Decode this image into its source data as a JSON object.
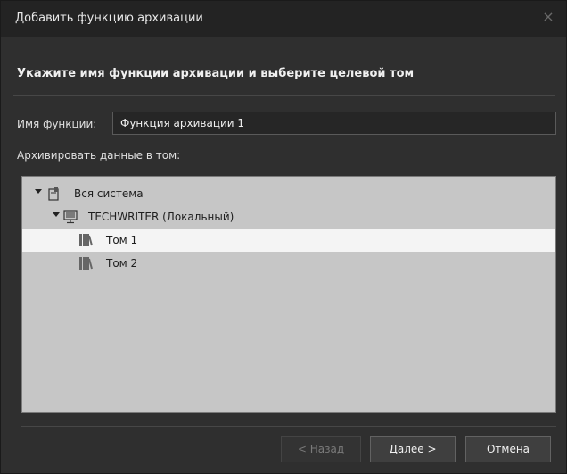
{
  "dialog": {
    "title": "Добавить функцию архивации",
    "close_glyph": "×",
    "heading": "Укажите имя функции архивации и выберите целевой том"
  },
  "form": {
    "name_label": "Имя функции:",
    "name_value": "Функция архивации 1",
    "volume_label": "Архивировать данные в том:"
  },
  "tree": {
    "items": [
      {
        "label": "Вся система",
        "icon": "system-icon",
        "expanded": true,
        "selected": false
      },
      {
        "label": "TECHWRITER (Локальный)",
        "icon": "computer-icon",
        "expanded": true,
        "selected": false
      },
      {
        "label": "Том 1",
        "icon": "volume-icon",
        "selected": true
      },
      {
        "label": "Том 2",
        "icon": "volume-icon",
        "selected": false
      }
    ]
  },
  "buttons": {
    "back_label": "< Назад",
    "back_enabled": false,
    "next_label": "Далее >",
    "cancel_label": "Отмена"
  },
  "colors": {
    "window_bg": "#2f2f2f",
    "tree_bg": "#c6c6c6",
    "selected_row_bg": "#f4f4f4"
  }
}
